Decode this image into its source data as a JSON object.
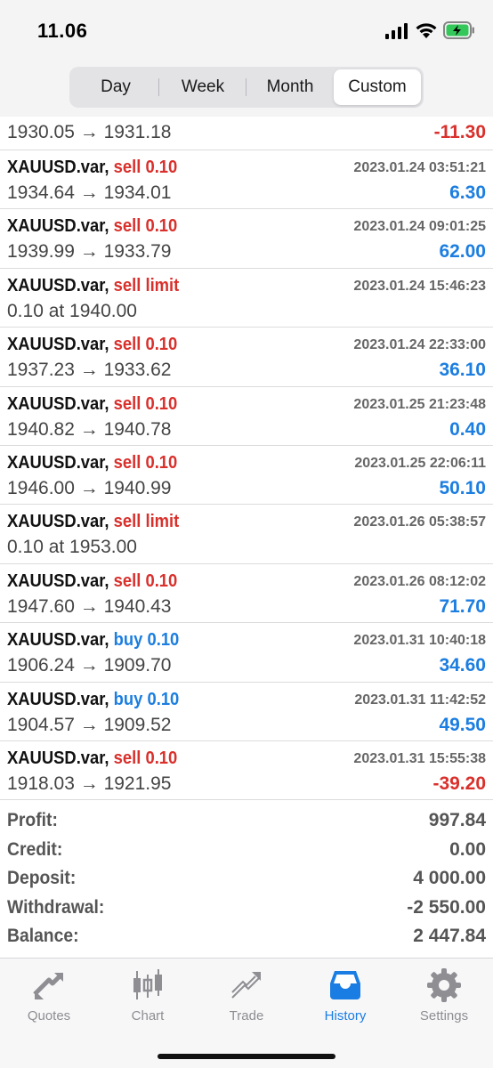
{
  "status": {
    "time": "11.06"
  },
  "segments": [
    {
      "label": "Day",
      "active": false
    },
    {
      "label": "Week",
      "active": false
    },
    {
      "label": "Month",
      "active": false
    },
    {
      "label": "Custom",
      "active": true
    }
  ],
  "first_row": {
    "prices": "1930.05 → 1931.18",
    "amount": "-11.30"
  },
  "trades": [
    {
      "symbol": "XAUUSD.var,",
      "side": "sell 0.10",
      "side_type": "sell",
      "datetime": "2023.01.24 03:51:21",
      "prices": "1934.64 → 1934.01",
      "amount": "6.30"
    },
    {
      "symbol": "XAUUSD.var,",
      "side": "sell 0.10",
      "side_type": "sell",
      "datetime": "2023.01.24 09:01:25",
      "prices": "1939.99 → 1933.79",
      "amount": "62.00"
    },
    {
      "symbol": "XAUUSD.var,",
      "side": "sell limit",
      "side_type": "sell",
      "datetime": "2023.01.24 15:46:23",
      "prices": "0.10 at 1940.00",
      "amount": ""
    },
    {
      "symbol": "XAUUSD.var,",
      "side": "sell 0.10",
      "side_type": "sell",
      "datetime": "2023.01.24 22:33:00",
      "prices": "1937.23 → 1933.62",
      "amount": "36.10"
    },
    {
      "symbol": "XAUUSD.var,",
      "side": "sell 0.10",
      "side_type": "sell",
      "datetime": "2023.01.25 21:23:48",
      "prices": "1940.82 → 1940.78",
      "amount": "0.40"
    },
    {
      "symbol": "XAUUSD.var,",
      "side": "sell 0.10",
      "side_type": "sell",
      "datetime": "2023.01.25 22:06:11",
      "prices": "1946.00 → 1940.99",
      "amount": "50.10"
    },
    {
      "symbol": "XAUUSD.var,",
      "side": "sell limit",
      "side_type": "sell",
      "datetime": "2023.01.26 05:38:57",
      "prices": "0.10 at 1953.00",
      "amount": ""
    },
    {
      "symbol": "XAUUSD.var,",
      "side": "sell 0.10",
      "side_type": "sell",
      "datetime": "2023.01.26 08:12:02",
      "prices": "1947.60 → 1940.43",
      "amount": "71.70"
    },
    {
      "symbol": "XAUUSD.var,",
      "side": "buy 0.10",
      "side_type": "buy",
      "datetime": "2023.01.31 10:40:18",
      "prices": "1906.24 → 1909.70",
      "amount": "34.60"
    },
    {
      "symbol": "XAUUSD.var,",
      "side": "buy 0.10",
      "side_type": "buy",
      "datetime": "2023.01.31 11:42:52",
      "prices": "1904.57 → 1909.52",
      "amount": "49.50"
    },
    {
      "symbol": "XAUUSD.var,",
      "side": "sell 0.10",
      "side_type": "sell",
      "datetime": "2023.01.31 15:55:38",
      "prices": "1918.03 → 1921.95",
      "amount": "-39.20"
    }
  ],
  "summary": [
    {
      "label": "Profit:",
      "value": "997.84"
    },
    {
      "label": "Credit:",
      "value": "0.00"
    },
    {
      "label": "Deposit:",
      "value": "4 000.00"
    },
    {
      "label": "Withdrawal:",
      "value": "-2 550.00"
    },
    {
      "label": "Balance:",
      "value": "2 447.84"
    }
  ],
  "tabs": [
    {
      "label": "Quotes",
      "icon": "quotes-icon",
      "active": false
    },
    {
      "label": "Chart",
      "icon": "chart-icon",
      "active": false
    },
    {
      "label": "Trade",
      "icon": "trade-icon",
      "active": false
    },
    {
      "label": "History",
      "icon": "history-icon",
      "active": true
    },
    {
      "label": "Settings",
      "icon": "settings-icon",
      "active": false
    }
  ],
  "colors": {
    "sell": "#d9302c",
    "buy": "#1c7ee0",
    "accent": "#1a7de3"
  }
}
